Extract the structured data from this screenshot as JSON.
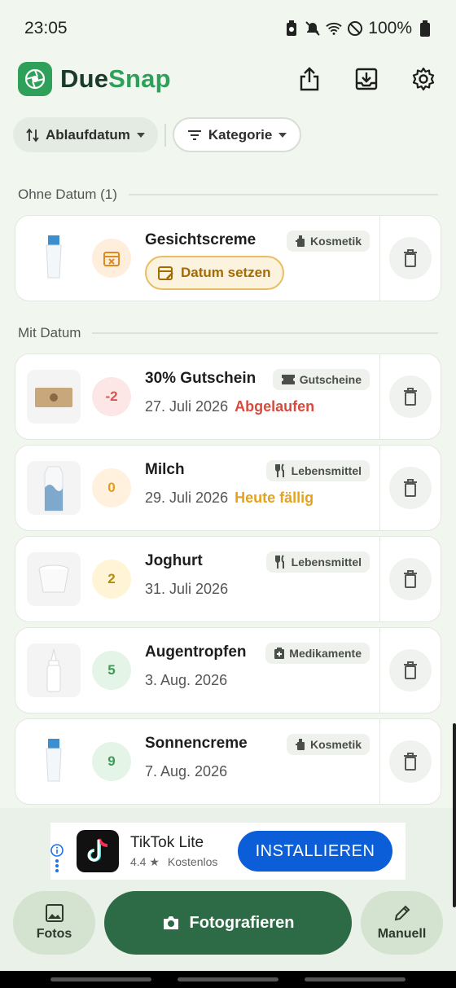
{
  "status": {
    "time": "23:05",
    "battery": "100%"
  },
  "app": {
    "brand_part1": "Due",
    "brand_part2": "Snap"
  },
  "filters": {
    "sort_label": "Ablaufdatum",
    "category_label": "Kategorie"
  },
  "sections": {
    "no_date": "Ohne Datum (1)",
    "with_date": "Mit Datum"
  },
  "undated_items": [
    {
      "name": "Gesichtscreme",
      "category": "Kosmetik",
      "action": "Datum setzen"
    }
  ],
  "items": [
    {
      "days": "-2",
      "name": "30% Gutschein",
      "date": "27. Juli 2026",
      "status": "Abgelaufen",
      "category": "Gutscheine",
      "badge_bg": "#FCE6E6",
      "badge_fg": "#D9534F",
      "status_color": "#D84A3E",
      "icon": "ticket-icon",
      "thumb": "voucher"
    },
    {
      "days": "0",
      "name": "Milch",
      "date": "29. Juli 2026",
      "status": "Heute fällig",
      "category": "Lebensmittel",
      "badge_bg": "#FFF1DD",
      "badge_fg": "#E69A1E",
      "status_color": "#E6A21C",
      "icon": "cutlery-icon",
      "thumb": "milk"
    },
    {
      "days": "2",
      "name": "Joghurt",
      "date": "31. Juli 2026",
      "status": "",
      "category": "Lebensmittel",
      "badge_bg": "#FFF5D6",
      "badge_fg": "#B58A12",
      "status_color": "#555555",
      "icon": "cutlery-icon",
      "thumb": "yogurt"
    },
    {
      "days": "5",
      "name": "Augentropfen",
      "date": "3. Aug. 2026",
      "status": "",
      "category": "Medikamente",
      "badge_bg": "#E4F4E6",
      "badge_fg": "#3E9B57",
      "status_color": "#555555",
      "icon": "medkit-icon",
      "thumb": "drops"
    },
    {
      "days": "9",
      "name": "Sonnencreme",
      "date": "7. Aug. 2026",
      "status": "",
      "category": "Kosmetik",
      "badge_bg": "#E4F4E6",
      "badge_fg": "#3E9B57",
      "status_color": "#555555",
      "icon": "cosmetic-icon",
      "thumb": "tube"
    }
  ],
  "ad": {
    "title": "TikTok Lite",
    "rating": "4.4 ★",
    "price": "Kostenlos",
    "cta": "INSTALLIEREN"
  },
  "bottom": {
    "photos": "Fotos",
    "camera": "Fotografieren",
    "manual": "Manuell"
  },
  "colors": {
    "accent": "#2FA05A",
    "primary_dark": "#2D6A46",
    "ad_button": "#0B5ED7"
  }
}
